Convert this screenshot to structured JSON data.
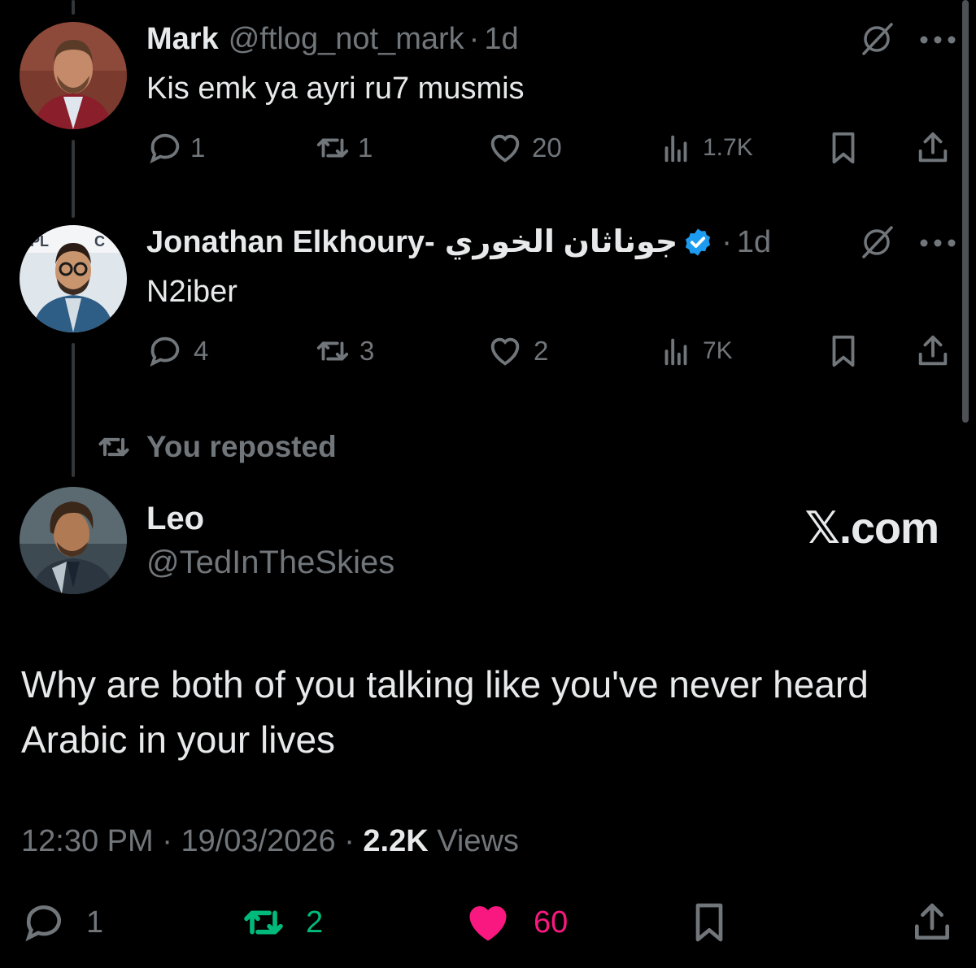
{
  "tweets": [
    {
      "name": "Mark",
      "handle": "@ftlog_not_mark",
      "dot": "·",
      "time": "1d",
      "text": "Kis emk ya ayri ru7 musmis",
      "replies": "1",
      "reposts": "1",
      "likes": "20",
      "views": "1.7K"
    },
    {
      "name": "Jonathan Elkhoury-",
      "name_arabic": "جوناثان الخوري",
      "dot": "·",
      "time": "1d",
      "text": "N2iber",
      "replies": "4",
      "reposts": "3",
      "likes": "2",
      "views": "7K"
    }
  ],
  "repost_label": "You reposted",
  "main_tweet": {
    "name": "Leo",
    "handle": "@TedInTheSkies",
    "text": "Why are both of you talking like you've never heard Arabic in your lives",
    "time": "12:30 PM",
    "date": "19/03/2026",
    "views_count": "2.2K",
    "views_label": "Views",
    "replies": "1",
    "reposts": "2",
    "likes": "60"
  },
  "watermark": "𝕏.com",
  "colors": {
    "background": "#000000",
    "text": "#e7e9ea",
    "muted": "#71767b",
    "verified": "#1d9bf0",
    "repost_active": "#00ba7c",
    "like_active": "#f91880"
  },
  "icons": [
    "reply-icon",
    "repost-icon",
    "like-icon",
    "views-icon",
    "bookmark-icon",
    "share-icon",
    "grok-icon",
    "more-icon",
    "verified-badge-icon"
  ]
}
